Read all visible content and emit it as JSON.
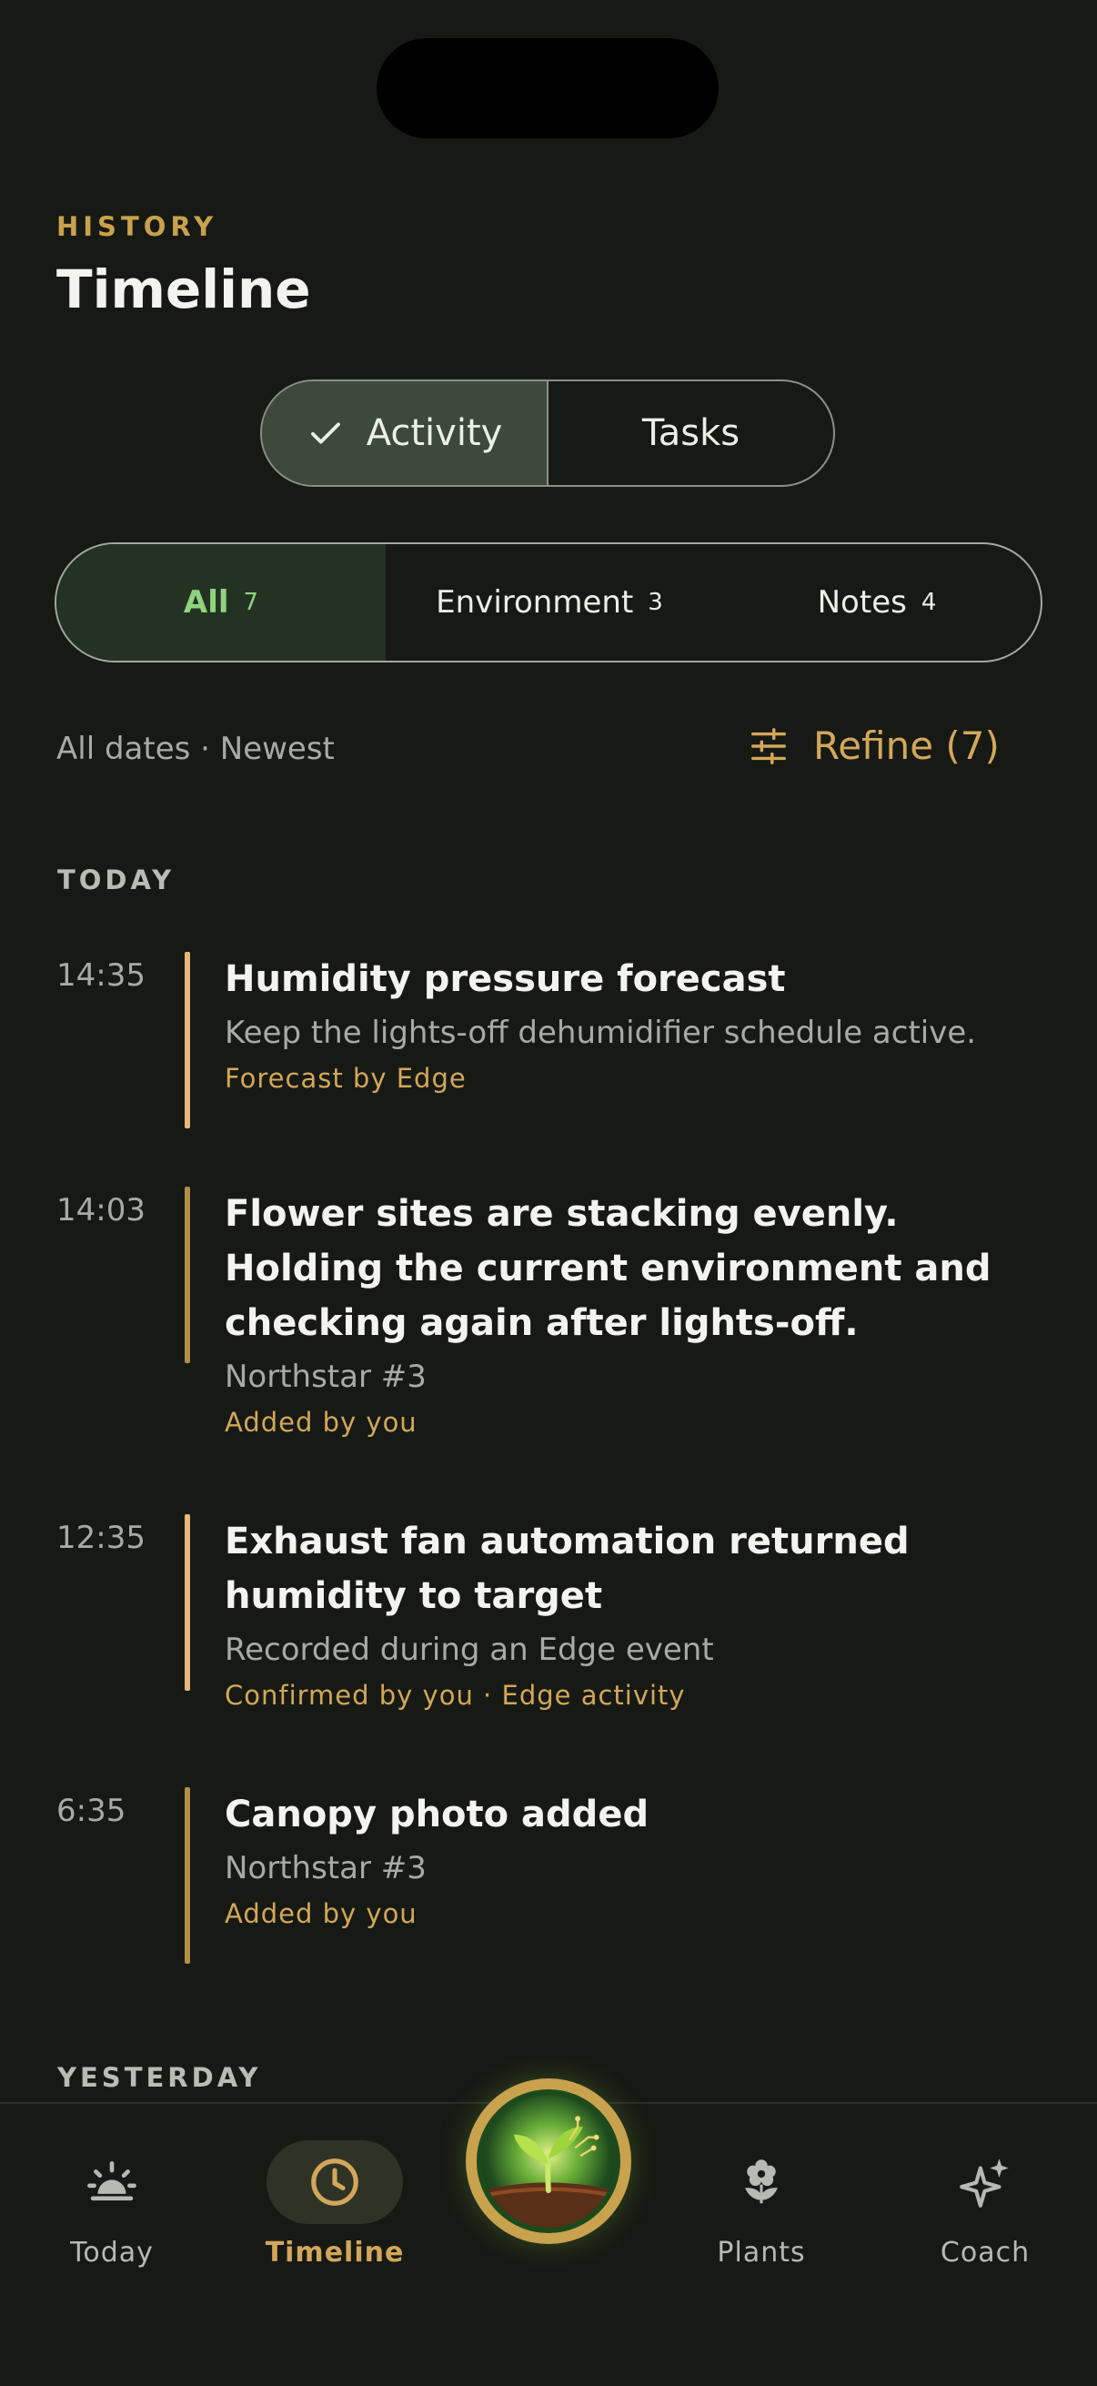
{
  "header": {
    "eyebrow": "HISTORY",
    "title": "Timeline"
  },
  "view_toggle": {
    "options": [
      {
        "label": "Activity",
        "selected": true
      },
      {
        "label": "Tasks",
        "selected": false
      }
    ]
  },
  "filters": [
    {
      "label": "All",
      "count": "7",
      "selected": true
    },
    {
      "label": "Environment",
      "count": "3",
      "selected": false
    },
    {
      "label": "Notes",
      "count": "4",
      "selected": false
    }
  ],
  "sort_label": "All dates · Newest",
  "refine_label": "Refine (7)",
  "sections": {
    "today": "TODAY",
    "yesterday": "YESTERDAY"
  },
  "entries": [
    {
      "time": "14:35",
      "title": "Humidity pressure forecast",
      "subtitle": "Keep the lights-off dehumidifier schedule active.",
      "meta": "Forecast by Edge",
      "accent": "#e7b879"
    },
    {
      "time": "14:03",
      "title": "Flower sites are stacking evenly. Holding the current environment and checking again after lights-off.",
      "subtitle": "Northstar #3",
      "meta": "Added by you",
      "accent": "#b38e45"
    },
    {
      "time": "12:35",
      "title": "Exhaust fan automation returned humidity to target",
      "subtitle": "Recorded during an Edge event",
      "meta": "Confirmed by you · Edge activity",
      "accent": "#e7b879"
    },
    {
      "time": "6:35",
      "title": "Canopy photo added",
      "subtitle": "Northstar #3",
      "meta": "Added by you",
      "accent": "#b38e45"
    }
  ],
  "nav": {
    "items": [
      {
        "label": "Today",
        "icon": "sunrise-icon"
      },
      {
        "label": "Timeline",
        "icon": "clock-icon",
        "active": true
      },
      {
        "label": "Plants",
        "icon": "flower-icon"
      },
      {
        "label": "Coach",
        "icon": "sparkles-icon"
      }
    ],
    "center_icon": "sprout-logo-icon"
  },
  "colors": {
    "background": "#171a14",
    "accent": "#d3a75a",
    "active_filter": "#8fd37f"
  }
}
